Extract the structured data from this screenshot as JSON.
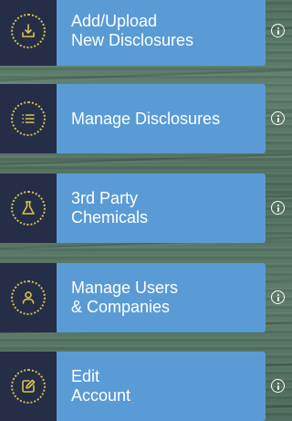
{
  "colors": {
    "icon_cell_bg": "#262d47",
    "icon_ring": "#d8c34a",
    "panel_bg": "#5a9bd6",
    "text": "#ffffff"
  },
  "menu": {
    "items": [
      {
        "line1": "Add/Upload",
        "line2": "New Disclosures",
        "icon": "upload-icon"
      },
      {
        "line1": "Manage Disclosures",
        "line2": "",
        "icon": "list-icon"
      },
      {
        "line1": "3rd Party",
        "line2": "Chemicals",
        "icon": "flask-icon"
      },
      {
        "line1": "Manage Users",
        "line2": "& Companies",
        "icon": "user-icon"
      },
      {
        "line1": "Edit",
        "line2": "Account",
        "icon": "edit-icon"
      }
    ],
    "info_icon": "info-icon"
  }
}
